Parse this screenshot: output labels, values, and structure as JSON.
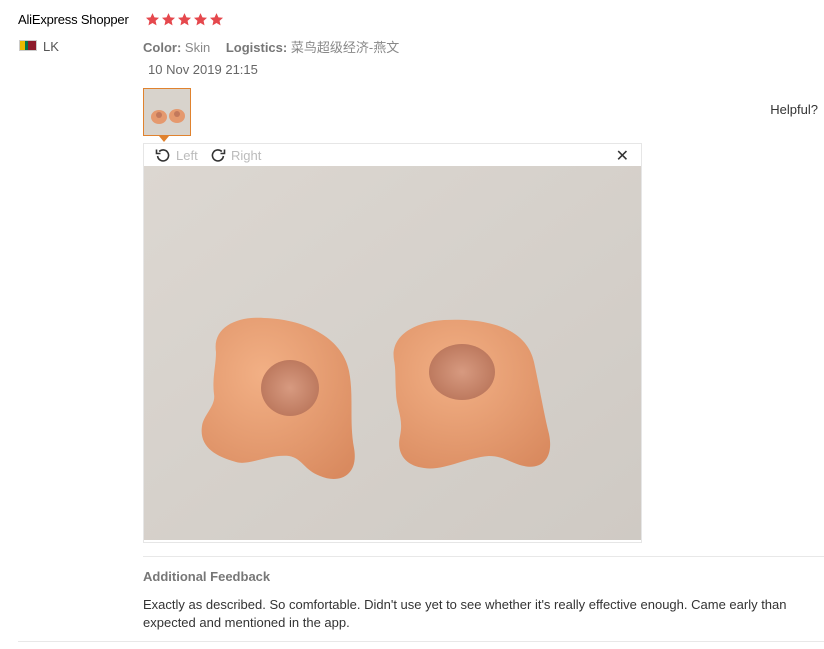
{
  "review": {
    "buyer_name": "AliExpress Shopper",
    "rating": 5,
    "country_code": "LK",
    "color_key": "Color:",
    "color_value": "Skin",
    "logistics_key": "Logistics:",
    "logistics_value": "菜鸟超级经济-燕文",
    "date": "10 Nov 2019 21:15",
    "helpful_label": "Helpful?",
    "viewer": {
      "rotate_left_label": "Left",
      "rotate_right_label": "Right",
      "close_glyph": "✕"
    },
    "additional_feedback": {
      "title": "Additional Feedback",
      "text": "Exactly as described. So comfortable. Didn't use yet to see whether it's really effective enough. Came early than expected and mentioned in the app."
    }
  },
  "colors": {
    "star": "#e5484d",
    "accent": "#e0822e"
  },
  "icons": [
    "star-icon",
    "flag-icon",
    "rotate-left-icon",
    "rotate-right-icon",
    "close-icon"
  ]
}
